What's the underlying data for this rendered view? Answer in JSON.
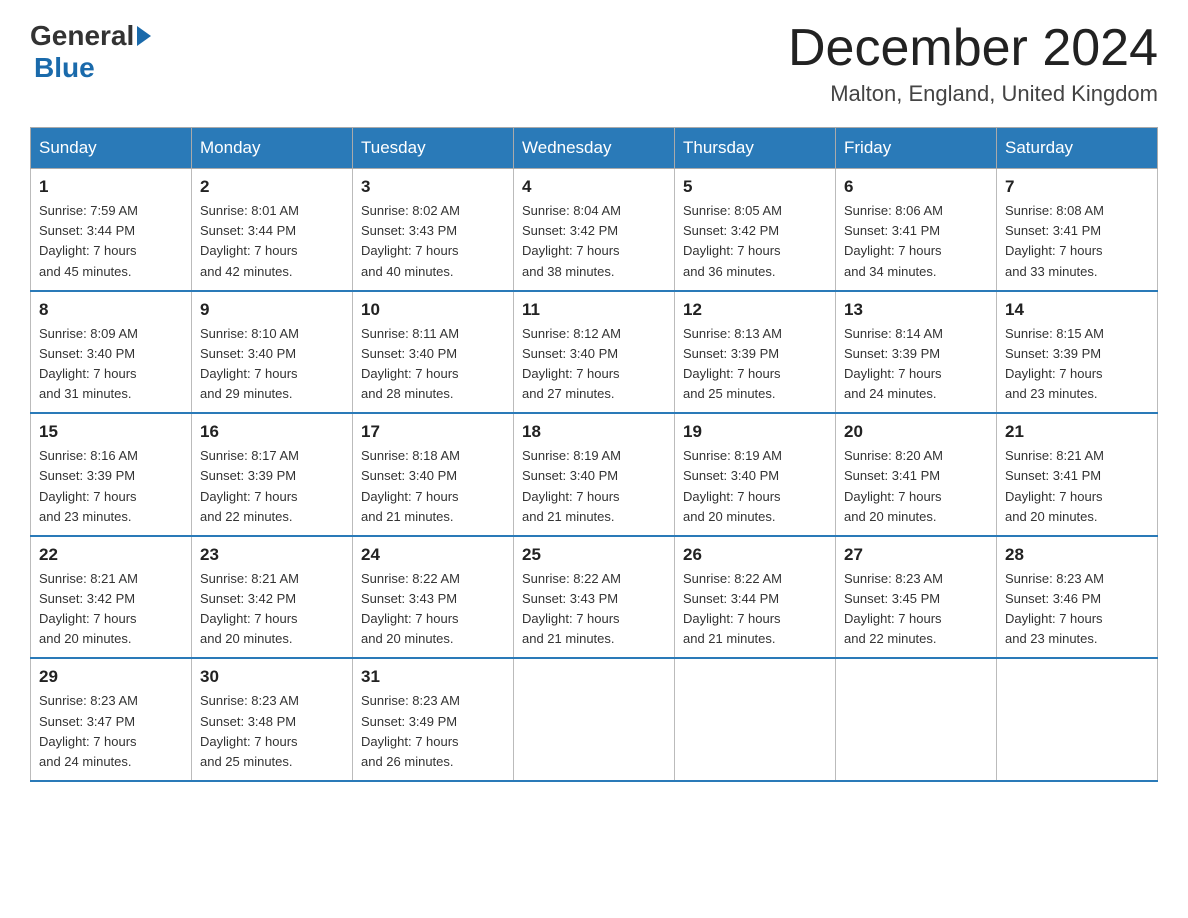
{
  "header": {
    "logo_general": "General",
    "logo_blue": "Blue",
    "title": "December 2024",
    "location": "Malton, England, United Kingdom"
  },
  "weekdays": [
    "Sunday",
    "Monday",
    "Tuesday",
    "Wednesday",
    "Thursday",
    "Friday",
    "Saturday"
  ],
  "weeks": [
    [
      {
        "day": "1",
        "sunrise": "7:59 AM",
        "sunset": "3:44 PM",
        "daylight": "7 hours and 45 minutes."
      },
      {
        "day": "2",
        "sunrise": "8:01 AM",
        "sunset": "3:44 PM",
        "daylight": "7 hours and 42 minutes."
      },
      {
        "day": "3",
        "sunrise": "8:02 AM",
        "sunset": "3:43 PM",
        "daylight": "7 hours and 40 minutes."
      },
      {
        "day": "4",
        "sunrise": "8:04 AM",
        "sunset": "3:42 PM",
        "daylight": "7 hours and 38 minutes."
      },
      {
        "day": "5",
        "sunrise": "8:05 AM",
        "sunset": "3:42 PM",
        "daylight": "7 hours and 36 minutes."
      },
      {
        "day": "6",
        "sunrise": "8:06 AM",
        "sunset": "3:41 PM",
        "daylight": "7 hours and 34 minutes."
      },
      {
        "day": "7",
        "sunrise": "8:08 AM",
        "sunset": "3:41 PM",
        "daylight": "7 hours and 33 minutes."
      }
    ],
    [
      {
        "day": "8",
        "sunrise": "8:09 AM",
        "sunset": "3:40 PM",
        "daylight": "7 hours and 31 minutes."
      },
      {
        "day": "9",
        "sunrise": "8:10 AM",
        "sunset": "3:40 PM",
        "daylight": "7 hours and 29 minutes."
      },
      {
        "day": "10",
        "sunrise": "8:11 AM",
        "sunset": "3:40 PM",
        "daylight": "7 hours and 28 minutes."
      },
      {
        "day": "11",
        "sunrise": "8:12 AM",
        "sunset": "3:40 PM",
        "daylight": "7 hours and 27 minutes."
      },
      {
        "day": "12",
        "sunrise": "8:13 AM",
        "sunset": "3:39 PM",
        "daylight": "7 hours and 25 minutes."
      },
      {
        "day": "13",
        "sunrise": "8:14 AM",
        "sunset": "3:39 PM",
        "daylight": "7 hours and 24 minutes."
      },
      {
        "day": "14",
        "sunrise": "8:15 AM",
        "sunset": "3:39 PM",
        "daylight": "7 hours and 23 minutes."
      }
    ],
    [
      {
        "day": "15",
        "sunrise": "8:16 AM",
        "sunset": "3:39 PM",
        "daylight": "7 hours and 23 minutes."
      },
      {
        "day": "16",
        "sunrise": "8:17 AM",
        "sunset": "3:39 PM",
        "daylight": "7 hours and 22 minutes."
      },
      {
        "day": "17",
        "sunrise": "8:18 AM",
        "sunset": "3:40 PM",
        "daylight": "7 hours and 21 minutes."
      },
      {
        "day": "18",
        "sunrise": "8:19 AM",
        "sunset": "3:40 PM",
        "daylight": "7 hours and 21 minutes."
      },
      {
        "day": "19",
        "sunrise": "8:19 AM",
        "sunset": "3:40 PM",
        "daylight": "7 hours and 20 minutes."
      },
      {
        "day": "20",
        "sunrise": "8:20 AM",
        "sunset": "3:41 PM",
        "daylight": "7 hours and 20 minutes."
      },
      {
        "day": "21",
        "sunrise": "8:21 AM",
        "sunset": "3:41 PM",
        "daylight": "7 hours and 20 minutes."
      }
    ],
    [
      {
        "day": "22",
        "sunrise": "8:21 AM",
        "sunset": "3:42 PM",
        "daylight": "7 hours and 20 minutes."
      },
      {
        "day": "23",
        "sunrise": "8:21 AM",
        "sunset": "3:42 PM",
        "daylight": "7 hours and 20 minutes."
      },
      {
        "day": "24",
        "sunrise": "8:22 AM",
        "sunset": "3:43 PM",
        "daylight": "7 hours and 20 minutes."
      },
      {
        "day": "25",
        "sunrise": "8:22 AM",
        "sunset": "3:43 PM",
        "daylight": "7 hours and 21 minutes."
      },
      {
        "day": "26",
        "sunrise": "8:22 AM",
        "sunset": "3:44 PM",
        "daylight": "7 hours and 21 minutes."
      },
      {
        "day": "27",
        "sunrise": "8:23 AM",
        "sunset": "3:45 PM",
        "daylight": "7 hours and 22 minutes."
      },
      {
        "day": "28",
        "sunrise": "8:23 AM",
        "sunset": "3:46 PM",
        "daylight": "7 hours and 23 minutes."
      }
    ],
    [
      {
        "day": "29",
        "sunrise": "8:23 AM",
        "sunset": "3:47 PM",
        "daylight": "7 hours and 24 minutes."
      },
      {
        "day": "30",
        "sunrise": "8:23 AM",
        "sunset": "3:48 PM",
        "daylight": "7 hours and 25 minutes."
      },
      {
        "day": "31",
        "sunrise": "8:23 AM",
        "sunset": "3:49 PM",
        "daylight": "7 hours and 26 minutes."
      },
      null,
      null,
      null,
      null
    ]
  ],
  "labels": {
    "sunrise": "Sunrise: ",
    "sunset": "Sunset: ",
    "daylight": "Daylight: "
  }
}
